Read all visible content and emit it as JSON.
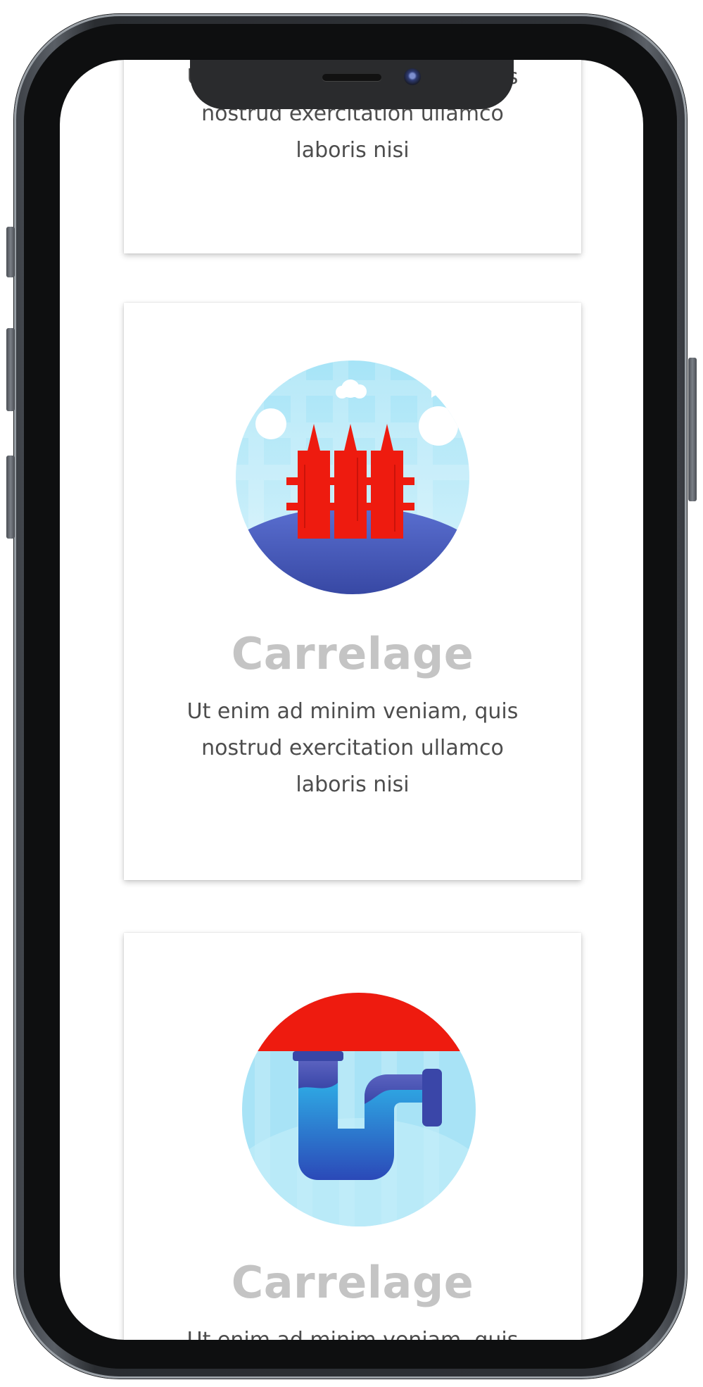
{
  "cards": [
    {
      "title": "",
      "text": "Ut enim ad minim veniam, quis nostrud exercitation ullamco laboris nisi"
    },
    {
      "title": "Carrelage",
      "text": "Ut enim ad minim veniam, quis nostrud exercitation ullamco laboris nisi",
      "icon": "fence-icon"
    },
    {
      "title": "Carrelage",
      "text": "Ut enim ad minim veniam, quis nostrud exercitation ullamco laboris nisi",
      "icon": "pipe-icon"
    }
  ],
  "colors": {
    "title": "#c4c4c4",
    "text": "#4d4d4d",
    "accent_red": "#ee1b0f",
    "accent_blue": "#3a4fb0",
    "sky_blue": "#a8e3f6"
  }
}
